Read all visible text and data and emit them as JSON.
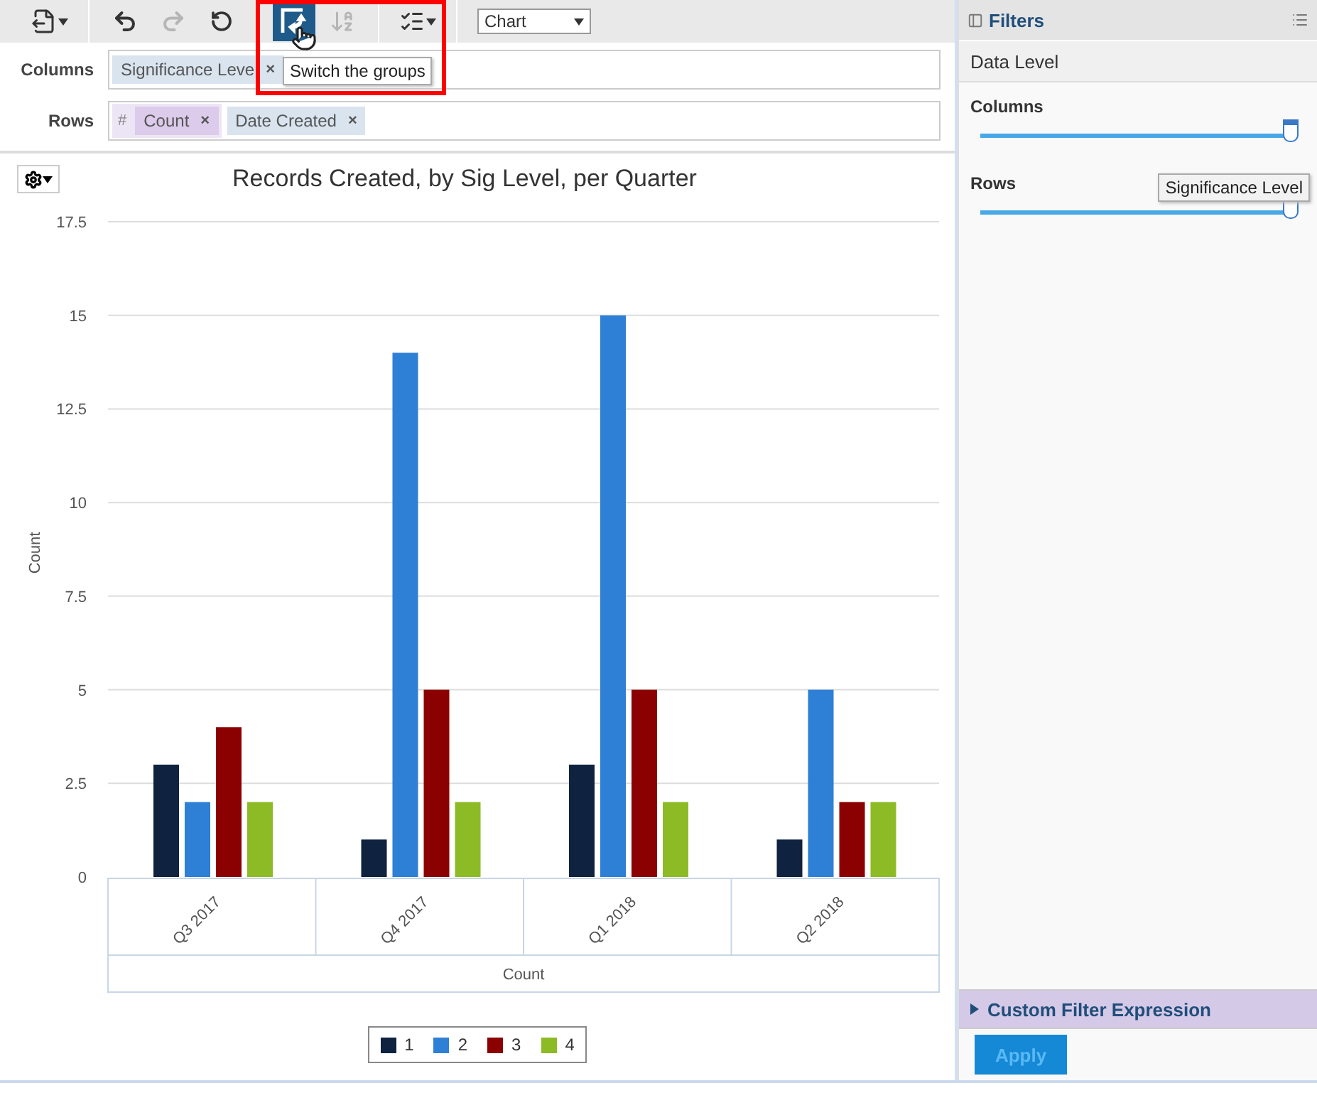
{
  "toolbar": {
    "tools": [
      {
        "kind": "export",
        "selected": false,
        "disabled": false
      },
      {
        "kind": "undo",
        "selected": false,
        "disabled": false
      },
      {
        "kind": "redo",
        "selected": false,
        "disabled": true
      },
      {
        "kind": "reset",
        "selected": false,
        "disabled": false
      },
      {
        "kind": "switch",
        "selected": true,
        "disabled": false
      },
      {
        "kind": "sort",
        "selected": false,
        "disabled": true
      },
      {
        "kind": "options",
        "selected": false,
        "disabled": false
      }
    ],
    "view_select": {
      "value": "Chart"
    },
    "tooltip": "Switch the groups"
  },
  "columns": {
    "label": "Columns",
    "chips": [
      {
        "label": "Significance Leve",
        "remove": "×"
      }
    ]
  },
  "rows": {
    "label": "Rows",
    "measure_group": {
      "symbol": "#",
      "chips": [
        {
          "label": "Count",
          "remove": "×"
        }
      ]
    },
    "chips": [
      {
        "label": "Date Created",
        "remove": "×"
      }
    ]
  },
  "chart": {
    "chart_data": {
      "type": "bar",
      "title": "Records Created, by Sig Level, per Quarter",
      "xlabel": "Count",
      "ylabel": "Count",
      "categories": [
        "Q3 2017",
        "Q4 2017",
        "Q1 2018",
        "Q2 2018"
      ],
      "series": [
        {
          "name": "1",
          "color": "#0f2340",
          "values": [
            3,
            1,
            3,
            1
          ]
        },
        {
          "name": "2",
          "color": "#2e7fd6",
          "values": [
            2,
            14,
            15,
            5
          ]
        },
        {
          "name": "3",
          "color": "#8b0000",
          "values": [
            4,
            5,
            5,
            2
          ]
        },
        {
          "name": "4",
          "color": "#8dbb26",
          "values": [
            2,
            2,
            2,
            2
          ]
        }
      ],
      "grid": true,
      "ylim": [
        0,
        17.5
      ],
      "yticks": [
        0,
        2.5,
        5,
        7.5,
        10,
        12.5,
        15,
        17.5
      ]
    }
  },
  "filters": {
    "title": "Filters",
    "section": "Data Level",
    "sliders": [
      {
        "label": "Columns",
        "level": 1
      },
      {
        "label": "Rows",
        "level": 1
      }
    ],
    "slider_tooltip": "Significance Level",
    "custom_filter": {
      "label": "Custom Filter Expression",
      "expanded": false
    },
    "apply": {
      "label": "Apply",
      "disabled": true
    }
  }
}
